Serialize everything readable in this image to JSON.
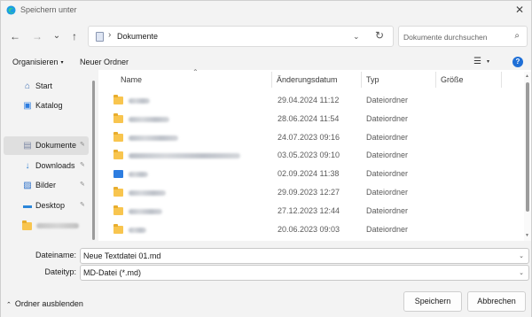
{
  "window": {
    "title": "Speichern unter",
    "close_glyph": "✕"
  },
  "nav": {
    "back_glyph": "←",
    "forward_glyph": "→",
    "recent_glyph": "⌄",
    "up_glyph": "↑",
    "address_sep": "›",
    "address_text": "Dokumente",
    "address_dd": "⌄",
    "refresh_glyph": "↻",
    "search_placeholder": "Dokumente durchsuchen",
    "search_glyph": "⌕"
  },
  "toolbar": {
    "organize_label": "Organisieren",
    "new_folder_label": "Neuer Ordner",
    "caret": "▾",
    "view_glyph": "☰",
    "help_glyph": "?"
  },
  "sidebar": {
    "items": [
      {
        "label": "Start",
        "icon": "home-icon",
        "glyph": "⌂",
        "color": "#3d6fb3"
      },
      {
        "label": "Katalog",
        "icon": "gallery-icon",
        "glyph": "▣",
        "color": "#2d7de0"
      },
      {
        "label": "Dokumente",
        "icon": "documents-icon",
        "glyph": "▤",
        "color": "#7e8aa6"
      },
      {
        "label": "Downloads",
        "icon": "downloads-icon",
        "glyph": "↓",
        "color": "#2f7fd1"
      },
      {
        "label": "Bilder",
        "icon": "pictures-icon",
        "glyph": "▨",
        "color": "#2a6fc9"
      },
      {
        "label": "Desktop",
        "icon": "desktop-icon",
        "glyph": "▬",
        "color": "#2b86d9"
      }
    ],
    "pin_glyph": "✎"
  },
  "columns": {
    "name": "Name",
    "date": "Änderungsdatum",
    "type": "Typ",
    "size": "Größe",
    "sort_glyph": "⌃"
  },
  "files": [
    {
      "icon": "folder-icon",
      "date": "29.04.2024 11:12",
      "type": "Dateiordner"
    },
    {
      "icon": "folder-icon",
      "date": "28.06.2024 11:54",
      "type": "Dateiordner"
    },
    {
      "icon": "folder-icon",
      "date": "24.07.2023 09:16",
      "type": "Dateiordner"
    },
    {
      "icon": "folder-icon",
      "date": "03.05.2023 09:10",
      "type": "Dateiordner"
    },
    {
      "icon": "image-folder-icon",
      "date": "02.09.2024 11:38",
      "type": "Dateiordner"
    },
    {
      "icon": "folder-icon",
      "date": "29.09.2023 12:27",
      "type": "Dateiordner"
    },
    {
      "icon": "folder-icon",
      "date": "27.12.2023 12:44",
      "type": "Dateiordner"
    },
    {
      "icon": "folder-icon",
      "date": "20.06.2023 09:03",
      "type": "Dateiordner"
    }
  ],
  "form": {
    "filename_label": "Dateiname:",
    "filename_value": "Neue Textdatei 01.md",
    "filetype_label": "Dateityp:",
    "filetype_value": "MD-Datei (*.md)",
    "dropdown_glyph": "⌄"
  },
  "footer": {
    "hide_folders_label": "Ordner ausblenden",
    "hide_glyph": "⌃",
    "save_label": "Speichern",
    "cancel_label": "Abbrechen"
  },
  "colors": {
    "accent": "#1f6fd6",
    "folder": "#f8c54f"
  }
}
